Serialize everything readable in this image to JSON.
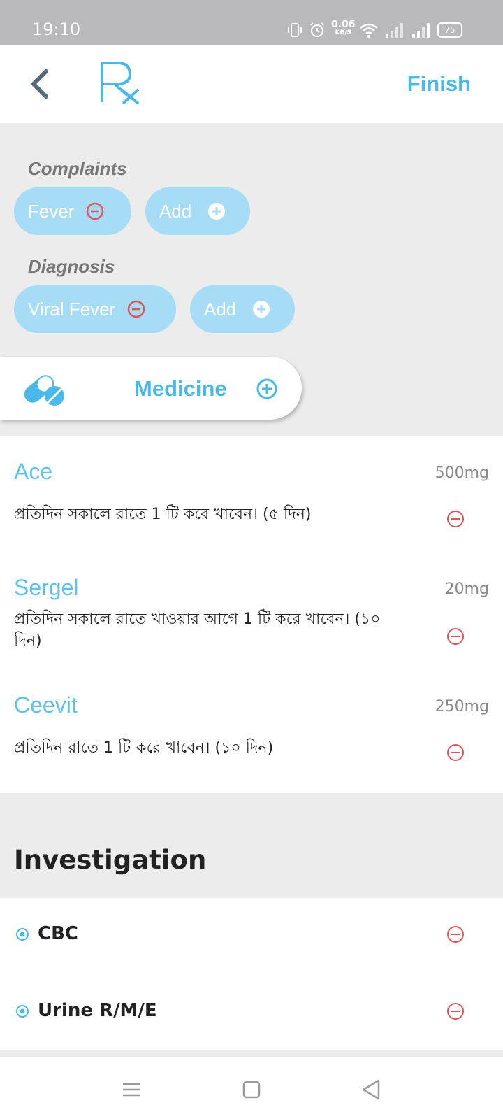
{
  "status_bar": {
    "time": "19:10",
    "net_speed_value": "0.06",
    "net_speed_unit": "KB/S",
    "battery": "75",
    "icons": [
      "vibrate-icon",
      "alarm-icon",
      "wifi-icon",
      "signal-icon",
      "signal-icon",
      "battery-icon"
    ]
  },
  "header": {
    "back_icon": "chevron-left-icon",
    "logo": "Rx",
    "finish_label": "Finish"
  },
  "complaints": {
    "label": "Complaints",
    "items": [
      {
        "label": "Fever"
      }
    ],
    "add_label": "Add"
  },
  "diagnosis": {
    "label": "Diagnosis",
    "items": [
      {
        "label": "Viral Fever"
      }
    ],
    "add_label": "Add"
  },
  "medicine": {
    "title": "Medicine",
    "icon": "pills-icon",
    "items": [
      {
        "name": "Ace",
        "dose": "500mg",
        "instruction": "প্রতিদিন সকালে রাতে 1 টি করে  খাবেন। (৫ দিন)"
      },
      {
        "name": "Sergel",
        "dose": "20mg",
        "instruction": "প্রতিদিন সকালে রাতে খাওয়ার আগে 1 টি করে  খাবেন। (১০ দিন)"
      },
      {
        "name": "Ceevit",
        "dose": "250mg",
        "instruction": "প্রতিদিন রাতে 1 টি করে  খাবেন। (১০ দিন)"
      }
    ]
  },
  "investigation": {
    "title": "Investigation",
    "items": [
      {
        "name": "CBC"
      },
      {
        "name": "Urine R/M/E"
      }
    ]
  },
  "colors": {
    "accent": "#4ab9e9",
    "chip": "#a6dcf5",
    "remove": "#e0525a",
    "background": "#ececec"
  },
  "nav_bar": {
    "icons": [
      "menu-icon",
      "home-square-icon",
      "back-triangle-icon"
    ]
  }
}
